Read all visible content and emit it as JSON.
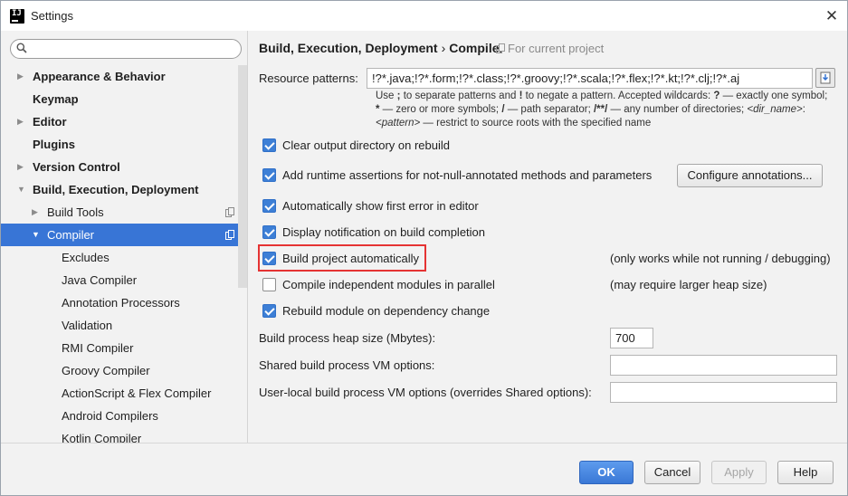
{
  "window": {
    "title": "Settings",
    "app_icon_text": "IJ"
  },
  "search": {
    "value": "",
    "placeholder": ""
  },
  "sidebar": {
    "items": [
      {
        "label": "Appearance & Behavior",
        "bold": true,
        "arrow": "right",
        "indent": 0
      },
      {
        "label": "Keymap",
        "bold": true,
        "arrow": "",
        "indent": 0
      },
      {
        "label": "Editor",
        "bold": true,
        "arrow": "right",
        "indent": 0
      },
      {
        "label": "Plugins",
        "bold": true,
        "arrow": "",
        "indent": 0
      },
      {
        "label": "Version Control",
        "bold": true,
        "arrow": "right",
        "indent": 0
      },
      {
        "label": "Build, Execution, Deployment",
        "bold": true,
        "arrow": "down",
        "indent": 0
      },
      {
        "label": "Build Tools",
        "bold": false,
        "arrow": "right",
        "indent": 1,
        "copy_icon": true
      },
      {
        "label": "Compiler",
        "bold": false,
        "arrow": "down",
        "indent": 1,
        "copy_icon": true,
        "selected": true
      },
      {
        "label": "Excludes",
        "bold": false,
        "arrow": "",
        "indent": 2
      },
      {
        "label": "Java Compiler",
        "bold": false,
        "arrow": "",
        "indent": 2
      },
      {
        "label": "Annotation Processors",
        "bold": false,
        "arrow": "",
        "indent": 2
      },
      {
        "label": "Validation",
        "bold": false,
        "arrow": "",
        "indent": 2
      },
      {
        "label": "RMI Compiler",
        "bold": false,
        "arrow": "",
        "indent": 2
      },
      {
        "label": "Groovy Compiler",
        "bold": false,
        "arrow": "",
        "indent": 2
      },
      {
        "label": "ActionScript & Flex Compiler",
        "bold": false,
        "arrow": "",
        "indent": 2
      },
      {
        "label": "Android Compilers",
        "bold": false,
        "arrow": "",
        "indent": 2
      },
      {
        "label": "Kotlin Compiler",
        "bold": false,
        "arrow": "",
        "indent": 2
      }
    ]
  },
  "breadcrumb": {
    "parent": "Build, Execution, Deployment",
    "separator": "›",
    "current": "Compiler",
    "scope": "For current project"
  },
  "resource_patterns": {
    "label": "Resource patterns:",
    "value": "!?*.java;!?*.form;!?*.class;!?*.groovy;!?*.scala;!?*.flex;!?*.kt;!?*.clj;!?*.aj",
    "hint": {
      "l1a": "Use ",
      "l1b": ";",
      "l1c": " to separate patterns and ",
      "l1d": "!",
      "l1e": " to negate a pattern. Accepted wildcards: ",
      "l1f": "?",
      "l1g": " — exactly one symbol;",
      "l2a": "*",
      "l2b": " — zero or more symbols; ",
      "l2c": "/",
      "l2d": " — path separator; ",
      "l2e": "/**/",
      "l2f": " — any number of directories; ",
      "l2g": "<dir_name>",
      "l2h": ":",
      "l3a": "<pattern>",
      "l3b": " — restrict to source roots with the specified name"
    }
  },
  "options": {
    "clear_output": {
      "label": "Clear output directory on rebuild",
      "checked": true
    },
    "runtime_assertions": {
      "label": "Add runtime assertions for not-null-annotated methods and parameters",
      "checked": true
    },
    "configure_annotations": "Configure annotations...",
    "show_first_error": {
      "label": "Automatically show first error in editor",
      "checked": true
    },
    "display_notification": {
      "label": "Display notification on build completion",
      "checked": true
    },
    "build_automatically": {
      "label": "Build project automatically",
      "checked": true,
      "note": "(only works while not running / debugging)"
    },
    "compile_parallel": {
      "label": "Compile independent modules in parallel",
      "checked": false,
      "note": "(may require larger heap size)"
    },
    "rebuild_on_dependency": {
      "label": "Rebuild module on dependency change",
      "checked": true
    }
  },
  "heap": {
    "label": "Build process heap size (Mbytes):",
    "value": "700"
  },
  "shared_vm": {
    "label": "Shared build process VM options:",
    "value": ""
  },
  "user_vm": {
    "label": "User-local build process VM options (overrides Shared options):",
    "value": ""
  },
  "buttons": {
    "ok": "OK",
    "cancel": "Cancel",
    "apply": "Apply",
    "help": "Help"
  },
  "colors": {
    "accent": "#3875d6",
    "checkbox": "#3d7fd6",
    "highlight": "#e53333"
  }
}
